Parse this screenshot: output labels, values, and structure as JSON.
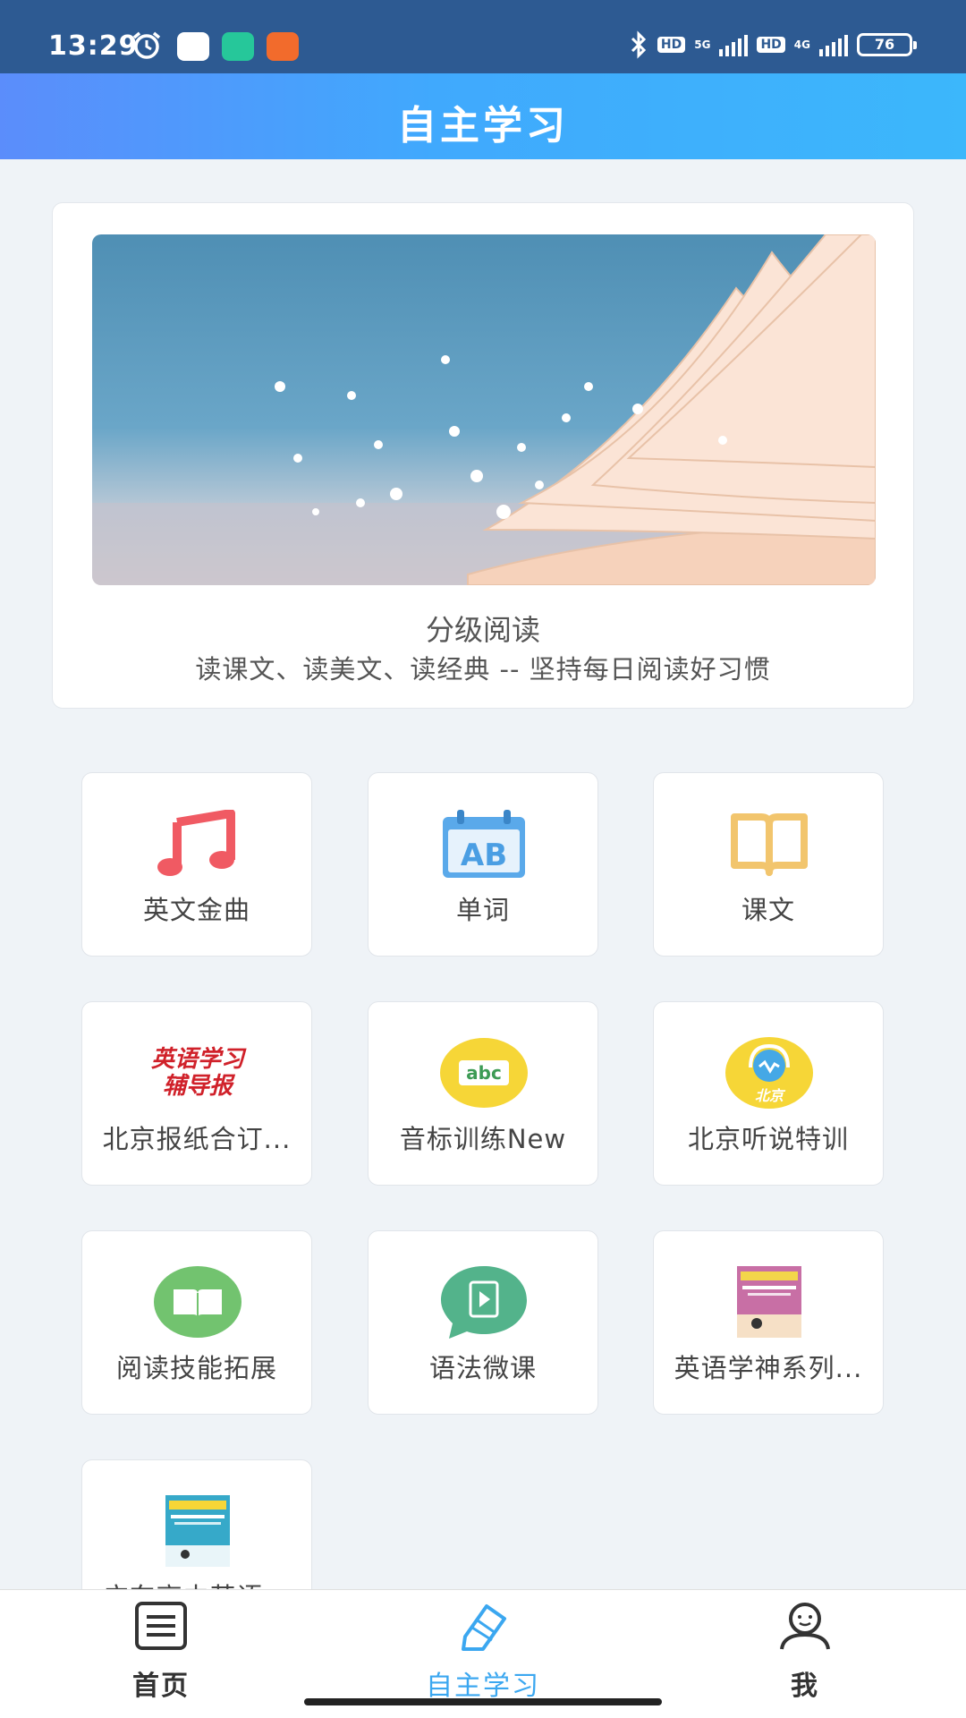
{
  "status_bar": {
    "time": "13:29",
    "network_1": "5G",
    "network_2": "4G",
    "hd_badge": "HD",
    "battery": "76"
  },
  "header": {
    "title": "自主学习"
  },
  "banner": {
    "title": "分级阅读",
    "subtitle": "读课文、读美文、读经典 -- 坚持每日阅读好习惯"
  },
  "tiles": [
    {
      "label": "英文金曲",
      "icon": "music-note-icon",
      "color": "#f05a63"
    },
    {
      "label": "单词",
      "icon": "ab-calendar-icon",
      "color": "#5aa9ea"
    },
    {
      "label": "课文",
      "icon": "open-book-icon",
      "color": "#f2c56d"
    },
    {
      "label": "北京报纸合订...",
      "icon": "newspaper-logo",
      "logo_text_1": "英语学习",
      "logo_text_2": "辅导报",
      "color": "#d0212a"
    },
    {
      "label": "音标训练New",
      "icon": "abc-icon",
      "logo_text": "abc",
      "color": "#f6d637"
    },
    {
      "label": "北京听说特训",
      "icon": "headset-icon",
      "logo_text": "北京",
      "color": "#f6d637"
    },
    {
      "label": "阅读技能拓展",
      "icon": "book-circle-icon",
      "color": "#72c36f"
    },
    {
      "label": "语法微课",
      "icon": "video-bubble-icon",
      "color": "#53b38b"
    },
    {
      "label": "英语学神系列...",
      "icon": "book-cover-icon",
      "color": "#c86fa5"
    },
    {
      "label": "广东高中英语...",
      "icon": "book-cover-icon-2",
      "color": "#36a9c9"
    }
  ],
  "bottom_nav": [
    {
      "label": "首页",
      "icon": "home-list-icon",
      "active": false
    },
    {
      "label": "自主学习",
      "icon": "study-pencil-icon",
      "active": true
    },
    {
      "label": "我",
      "icon": "profile-icon",
      "active": false
    }
  ]
}
